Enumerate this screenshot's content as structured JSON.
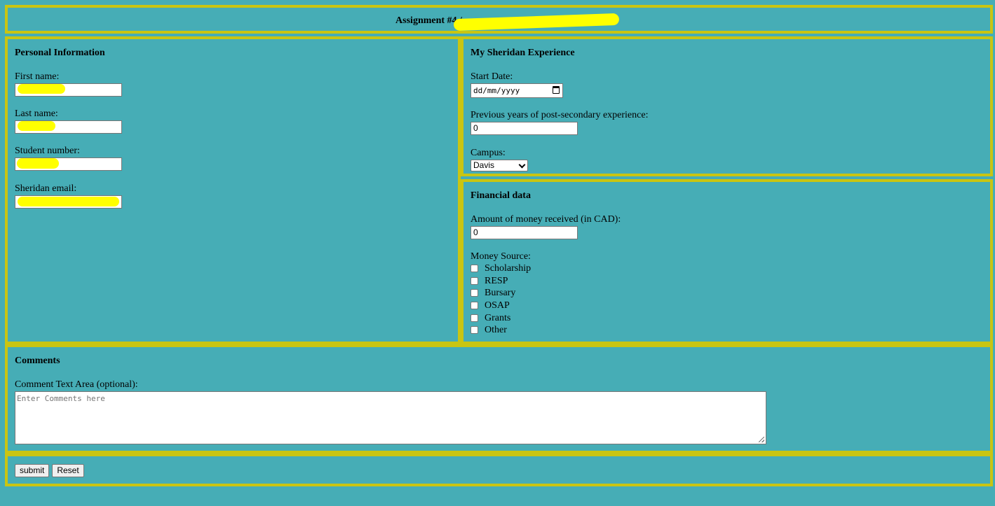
{
  "header": {
    "title": "Assignment #4 /"
  },
  "personal": {
    "title": "Personal Information",
    "fields": [
      {
        "label": "First name:",
        "value": ""
      },
      {
        "label": "Last name:",
        "value": ""
      },
      {
        "label": "Student number:",
        "value": ""
      },
      {
        "label": "Sheridan email:",
        "value": ""
      }
    ]
  },
  "experience": {
    "title": "My Sheridan Experience",
    "start_date_label": "Start Date:",
    "start_date_placeholder": "dd/mm/yyyy",
    "years_label": "Previous years of post-secondary experience:",
    "years_value": "0",
    "campus_label": "Campus:",
    "campus_value": "Davis"
  },
  "financial": {
    "title": "Financial data",
    "amount_label": "Amount of money received (in CAD):",
    "amount_value": "0",
    "source_label": "Money Source:",
    "sources": [
      "Scholarship",
      "RESP",
      "Bursary",
      "OSAP",
      "Grants",
      "Other"
    ]
  },
  "comments": {
    "title": "Comments",
    "textarea_label": "Comment Text Area (optional):",
    "placeholder": "Enter Comments here"
  },
  "actions": {
    "submit_label": "submit",
    "reset_label": "Reset"
  },
  "colors": {
    "background": "#46adb6",
    "border": "#c9c512",
    "redaction": "#ffff00"
  }
}
